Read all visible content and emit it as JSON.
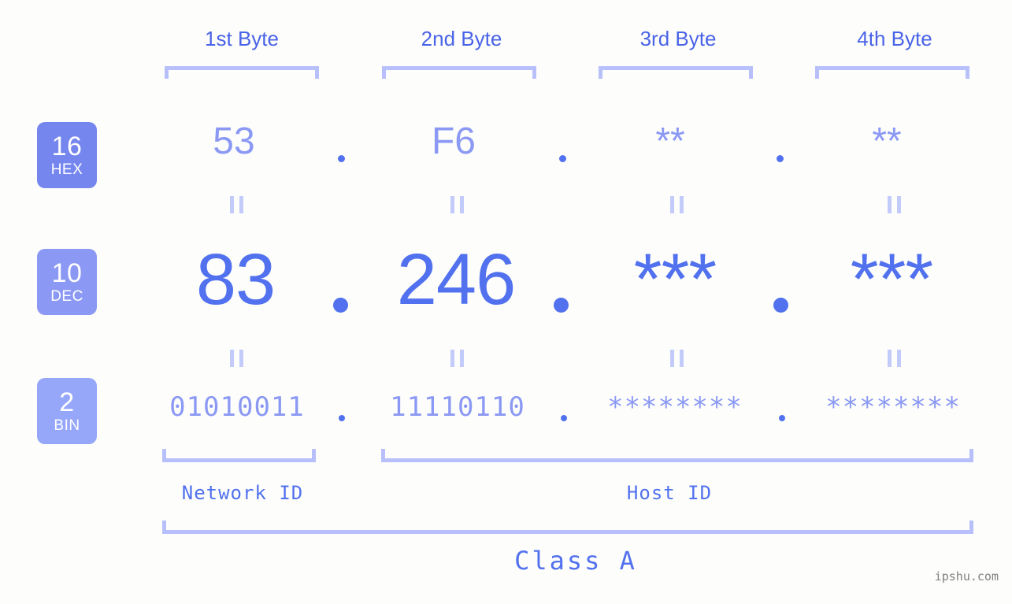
{
  "watermark": "ipshu.com",
  "columns": [
    {
      "header": "1st Byte"
    },
    {
      "header": "2nd Byte"
    },
    {
      "header": "3rd Byte"
    },
    {
      "header": "4th Byte"
    }
  ],
  "bases": [
    {
      "num": "16",
      "name": "HEX",
      "color": "#7586ef"
    },
    {
      "num": "10",
      "name": "DEC",
      "color": "#8b99f4"
    },
    {
      "num": "2",
      "name": "BIN",
      "color": "#96a7fa"
    }
  ],
  "rows": {
    "hex": {
      "values": [
        "53",
        "F6",
        "**",
        "**"
      ]
    },
    "dec": {
      "values": [
        "83",
        "246",
        "***",
        "***"
      ]
    },
    "bin": {
      "values": [
        "01010011",
        "11110110",
        "********",
        "********"
      ]
    }
  },
  "separators": {
    "dot": ".",
    "equals": "||"
  },
  "sections": {
    "network_id": "Network ID",
    "host_id": "Host ID",
    "class": "Class A"
  },
  "colors": {
    "background": "#fdfefb",
    "accent_strong": "#5271ee",
    "accent_mid": "#8b99f4",
    "accent_light": "#b7c0fa",
    "badge_hex": "#7586ef",
    "badge_dec": "#8b99f4",
    "badge_bin": "#96a7fa",
    "watermark": "#808080"
  }
}
